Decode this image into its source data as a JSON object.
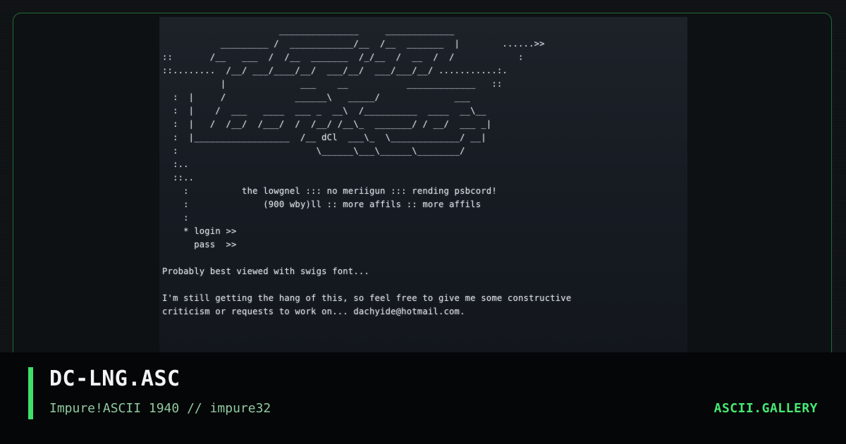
{
  "artwork": {
    "text": "                      _______________     _____________\n           _________ /  ____________/__  /__  _______  |        ......>>\n::       /__   ___  /  /__  _______  /_/__  /  __  /  /            :\n::........  /__/ ___/____/__/  ___/__/  ___/___/__/ ...........:.\n           |              ___    __           _____________   ::\n  :  |     /             ______\\   _____/              ___\n  :  |    /  ___   ____  ___ _  __\\  /__________  ____  __\\__\n  :  |   /  /__/  /___/  /  /__/ /__\\_  _______/ / __/  ___ _|\n  :  |__________________  /__ dCl  ___\\_  \\_____________/ __|\n  :                          \\______\\___\\______\\________/\n  :..\n  ::.. \n    :          the lowgnel ::: no meriigun ::: rending psbcord!\n    :              (900 wby)ll :: more affils :: more affils\n    :\n    * login >>\n      pass  >>\n\nProbably best viewed with swigs font...\n\nI'm still getting the hang of this, so feel free to give me some constructive\ncriticism or requests to work on... dachyide@hotmail.com."
  },
  "footer": {
    "title": "DC-LNG.ASC",
    "subtitle": "Impure!ASCII 1940 // impure32",
    "brand": "ASCII.GALLERY"
  },
  "colors": {
    "accent": "#3ee06a",
    "brand": "#46e873",
    "subtitle": "#8fc9a0",
    "frame_border": "#1f6b35"
  }
}
